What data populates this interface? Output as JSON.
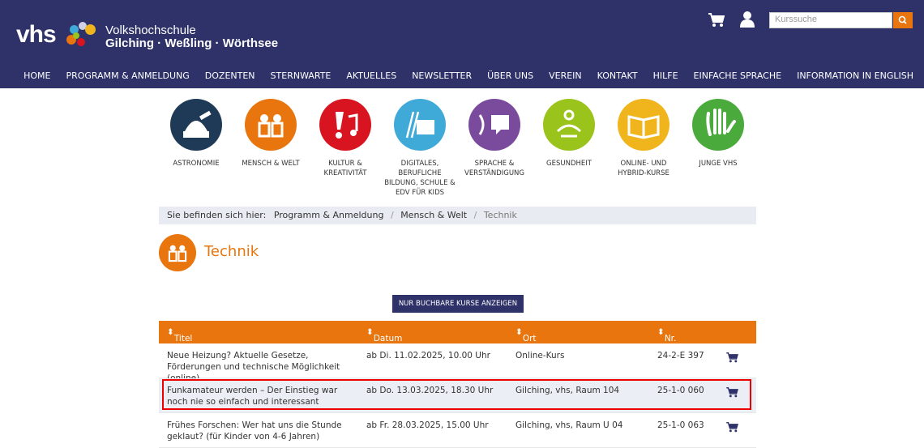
{
  "header": {
    "logo_text": "vhs",
    "brand_line1": "Volkshochschule",
    "brand_line2": "Gilching · Weßling · Wörthsee",
    "search_placeholder": "Kurssuche"
  },
  "nav": [
    "HOME",
    "PROGRAMM & ANMELDUNG",
    "DOZENTEN",
    "STERNWARTE",
    "AKTUELLES",
    "NEWSLETTER",
    "ÜBER UNS",
    "VEREIN",
    "KONTAKT",
    "HILFE",
    "EINFACHE SPRACHE",
    "INFORMATION IN ENGLISH"
  ],
  "categories": [
    {
      "label": "ASTRONOMIE",
      "color": "#1f3a56"
    },
    {
      "label": "MENSCH & WELT",
      "color": "#e8750d"
    },
    {
      "label": "KULTUR & KREATIVITÄT",
      "color": "#d7141f"
    },
    {
      "label": "DIGITALES, BERUFLICHE BILDUNG, SCHULE & EDV FÜR KIDS",
      "color": "#3fa9d8"
    },
    {
      "label": "SPRACHE & VERSTÄNDIGUNG",
      "color": "#7a4b9c"
    },
    {
      "label": "GESUNDHEIT",
      "color": "#9ac31c"
    },
    {
      "label": "ONLINE- UND HYBRID-KURSE",
      "color": "#f0b51c"
    },
    {
      "label": "JUNGE VHS",
      "color": "#4aaa3c"
    }
  ],
  "breadcrumb": {
    "prefix": "Sie befinden sich hier:",
    "items": [
      "Programm & Anmeldung",
      "Mensch & Welt"
    ],
    "sep": "/",
    "current": "Technik"
  },
  "page_title": "Technik",
  "filter_button": "NUR BUCHBARE KURSE ANZEIGEN",
  "table": {
    "headers": [
      "Titel",
      "Datum",
      "Ort",
      "Nr."
    ],
    "rows": [
      {
        "title": "Neue Heizung? Aktuelle Gesetze, Förderungen und technische Möglichkeit (online)",
        "date": "ab Di. 11.02.2025, 10.00 Uhr",
        "place": "Online-Kurs",
        "nr": "24-2-E 397"
      },
      {
        "title": "Funkamateur werden – Der Einstieg war noch nie so einfach und interessant",
        "date": "ab Do. 13.03.2025, 18.30 Uhr",
        "place": "Gilching, vhs, Raum 104",
        "nr": "25-1-0 060"
      },
      {
        "title": "Frühes Forschen: Wer hat uns die Stunde geklaut? (für Kinder von 4-6 Jahren)",
        "date": "ab Fr. 28.03.2025, 15.00 Uhr",
        "place": "Gilching, vhs, Raum U 04",
        "nr": "25-1-0 063"
      }
    ]
  },
  "colors": {
    "navy": "#2e3269",
    "orange": "#e8750d",
    "highlight": "#e00000"
  }
}
